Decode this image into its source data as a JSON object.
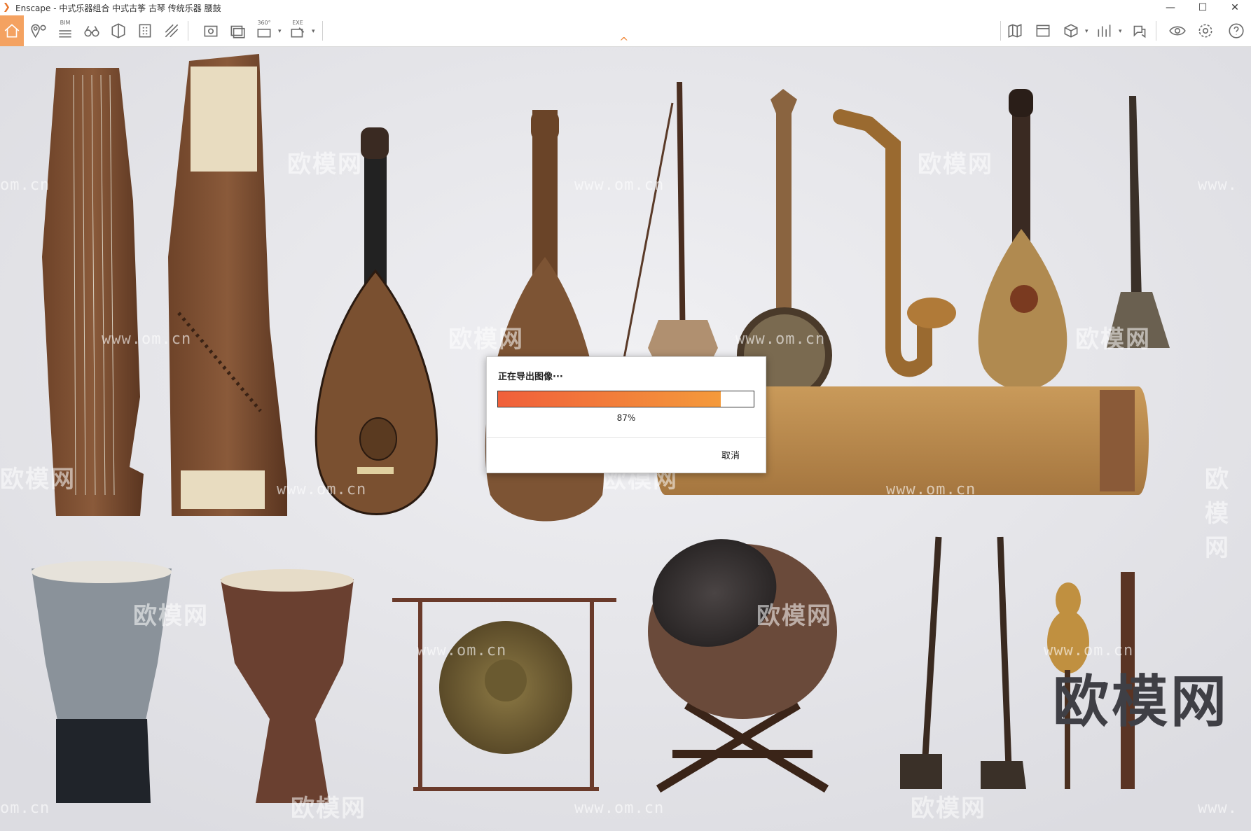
{
  "window": {
    "title": "Enscape - 中式乐器组合 中式古筝 古琴 传统乐器 腰鼓",
    "minimize": "—",
    "maximize": "☐",
    "close": "✕"
  },
  "toolbar": {
    "bim_label": "BIM",
    "pano_label": "360°",
    "exe_label": "EXE",
    "collapse_glyph": "^"
  },
  "watermarks": {
    "brand": "欧模网",
    "url": "www.om.cn",
    "url_partial_left": "om.cn",
    "url_partial_right": "www.",
    "brand_partial": "欧模网"
  },
  "export_dialog": {
    "title": "正在导出图像···",
    "progress_percent": 87,
    "progress_label": "87%",
    "cancel_label": "取消"
  },
  "colors": {
    "accent": "#f4a261",
    "progress_start": "#f05f3a",
    "progress_end": "#f49a3b",
    "background": "#e9e9ed"
  }
}
